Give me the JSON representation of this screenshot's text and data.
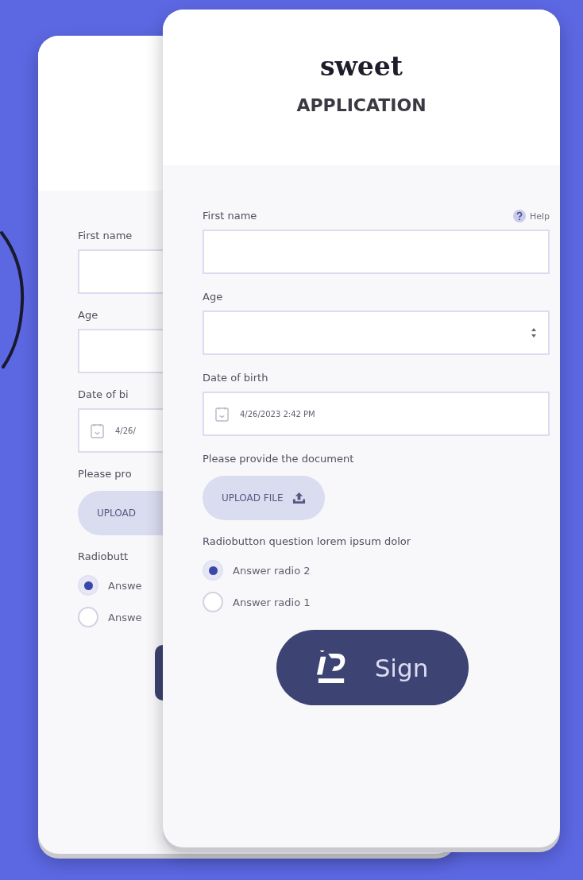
{
  "back_card": {
    "fields": [
      {
        "kind": "text",
        "label": "First name"
      },
      {
        "kind": "number",
        "label": "Age"
      },
      {
        "kind": "date",
        "label": "Date of bi",
        "value": "4/26/"
      }
    ],
    "upload": {
      "label": "Please pro",
      "button": "UPLOAD"
    },
    "radio": {
      "question": "Radiobutt",
      "options": [
        {
          "label": "Answe",
          "selected": true
        },
        {
          "label": "Answe",
          "selected": false
        }
      ]
    }
  },
  "front_card": {
    "brand": "sweet",
    "title": "APPLICATION",
    "help": "Help",
    "fields": [
      {
        "kind": "text",
        "label": "First name"
      },
      {
        "kind": "number",
        "label": "Age"
      },
      {
        "kind": "date",
        "label": "Date of birth",
        "value": "4/26/2023 2:42 PM"
      }
    ],
    "upload": {
      "label": "Please provide the document",
      "button": "UPLOAD FILE"
    },
    "radio": {
      "question": "Radiobutton question lorem ipsum dolor",
      "options": [
        {
          "label": "Answer radio 2",
          "selected": true
        },
        {
          "label": "Answer radio 1",
          "selected": false
        }
      ]
    },
    "sign_button": "Sign"
  }
}
